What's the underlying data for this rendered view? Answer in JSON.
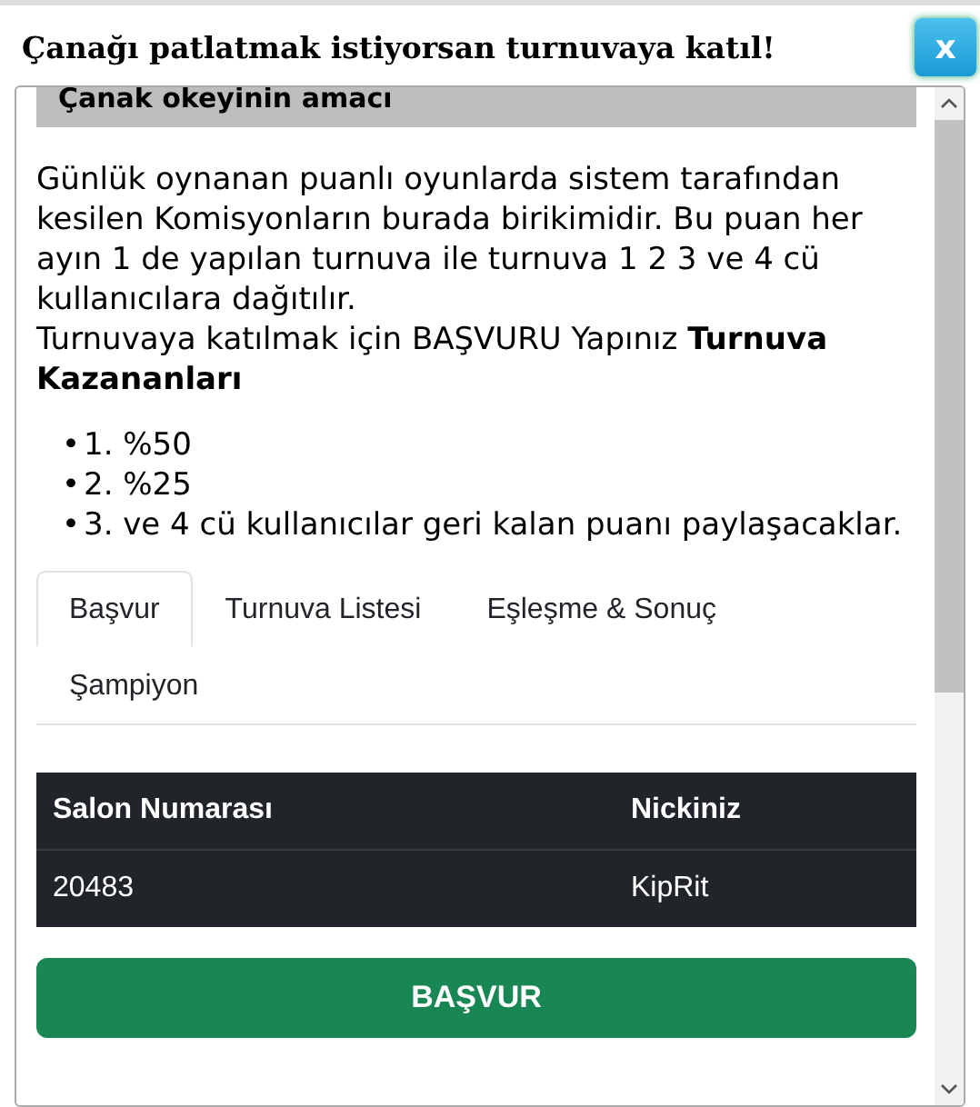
{
  "dialog": {
    "title": "Çanağı patlatmak istiyorsan turnuvaya katıl!",
    "close_label": "x"
  },
  "section_header": "Çanak okeyinin amacı",
  "paragraphs": [
    "Günlük oynanan puanlı oyunlarda sistem tarafından kesilen Komisyonların burada birikimidir. Bu puan her ayın 1 de yapılan turnuva ile turnuva 1 2 3 ve 4 cü kullanıcılara dağıtılır.",
    "Turnuvaya katılmak için BAŞVURU Yapınız **Turnuva Kazananları**"
  ],
  "prizes": [
    {
      "marker": "•",
      "text": "1. %50"
    },
    {
      "marker": "•",
      "text": "2. %25"
    },
    {
      "marker": "•",
      "text": "3. ve 4 cü kullanıcılar geri kalan puanı paylaşacaklar."
    }
  ],
  "tabs": [
    {
      "label": "Başvur",
      "selected": true
    },
    {
      "label": "Turnuva Listesi",
      "selected": false
    },
    {
      "label": "Eşleşme & Sonuç",
      "selected": false
    },
    {
      "label": "Şampiyon",
      "selected": false
    }
  ],
  "table": {
    "columns": [
      "Salon Numarası",
      "Nickiniz"
    ],
    "rows": [
      [
        "20483",
        "KipRit"
      ]
    ]
  },
  "submit_button": "BAŞVUR"
}
